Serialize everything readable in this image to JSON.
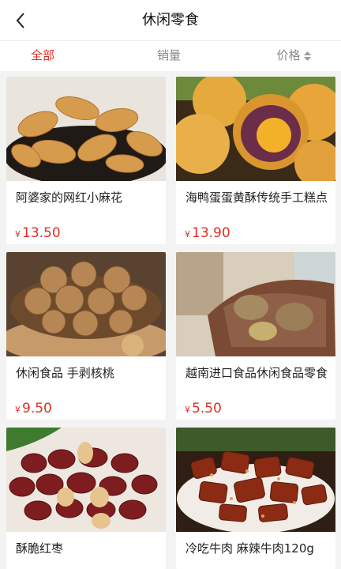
{
  "header": {
    "title": "休闲零食"
  },
  "tabs": [
    {
      "label": "全部",
      "active": true
    },
    {
      "label": "销量",
      "active": false
    },
    {
      "label": "价格",
      "active": false
    }
  ],
  "icons": {
    "back": "chevron-left-icon",
    "sort": "sort-updown-icon"
  },
  "colors": {
    "accent": "#e02e24"
  },
  "products": [
    {
      "name": "阿婆家的网红小麻花",
      "currency": "¥",
      "price": "13.50",
      "image": "twisted-fried-dough-photo"
    },
    {
      "name": "海鸭蛋蛋黄酥传统手工糕点",
      "currency": "¥",
      "price": "13.90",
      "image": "egg-yolk-pastry-photo"
    },
    {
      "name": "休闲食品 手剥核桃",
      "currency": "¥",
      "price": "9.50",
      "image": "walnuts-photo"
    },
    {
      "name": "越南进口食品休闲食品零食",
      "currency": "¥",
      "price": "5.50",
      "image": "chestnut-cake-photo"
    },
    {
      "name": "酥脆红枣",
      "currency": "",
      "price": "",
      "image": "red-dates-photo"
    },
    {
      "name": "冷吃牛肉 麻辣牛肉120g",
      "currency": "",
      "price": "",
      "image": "spicy-beef-photo"
    }
  ]
}
